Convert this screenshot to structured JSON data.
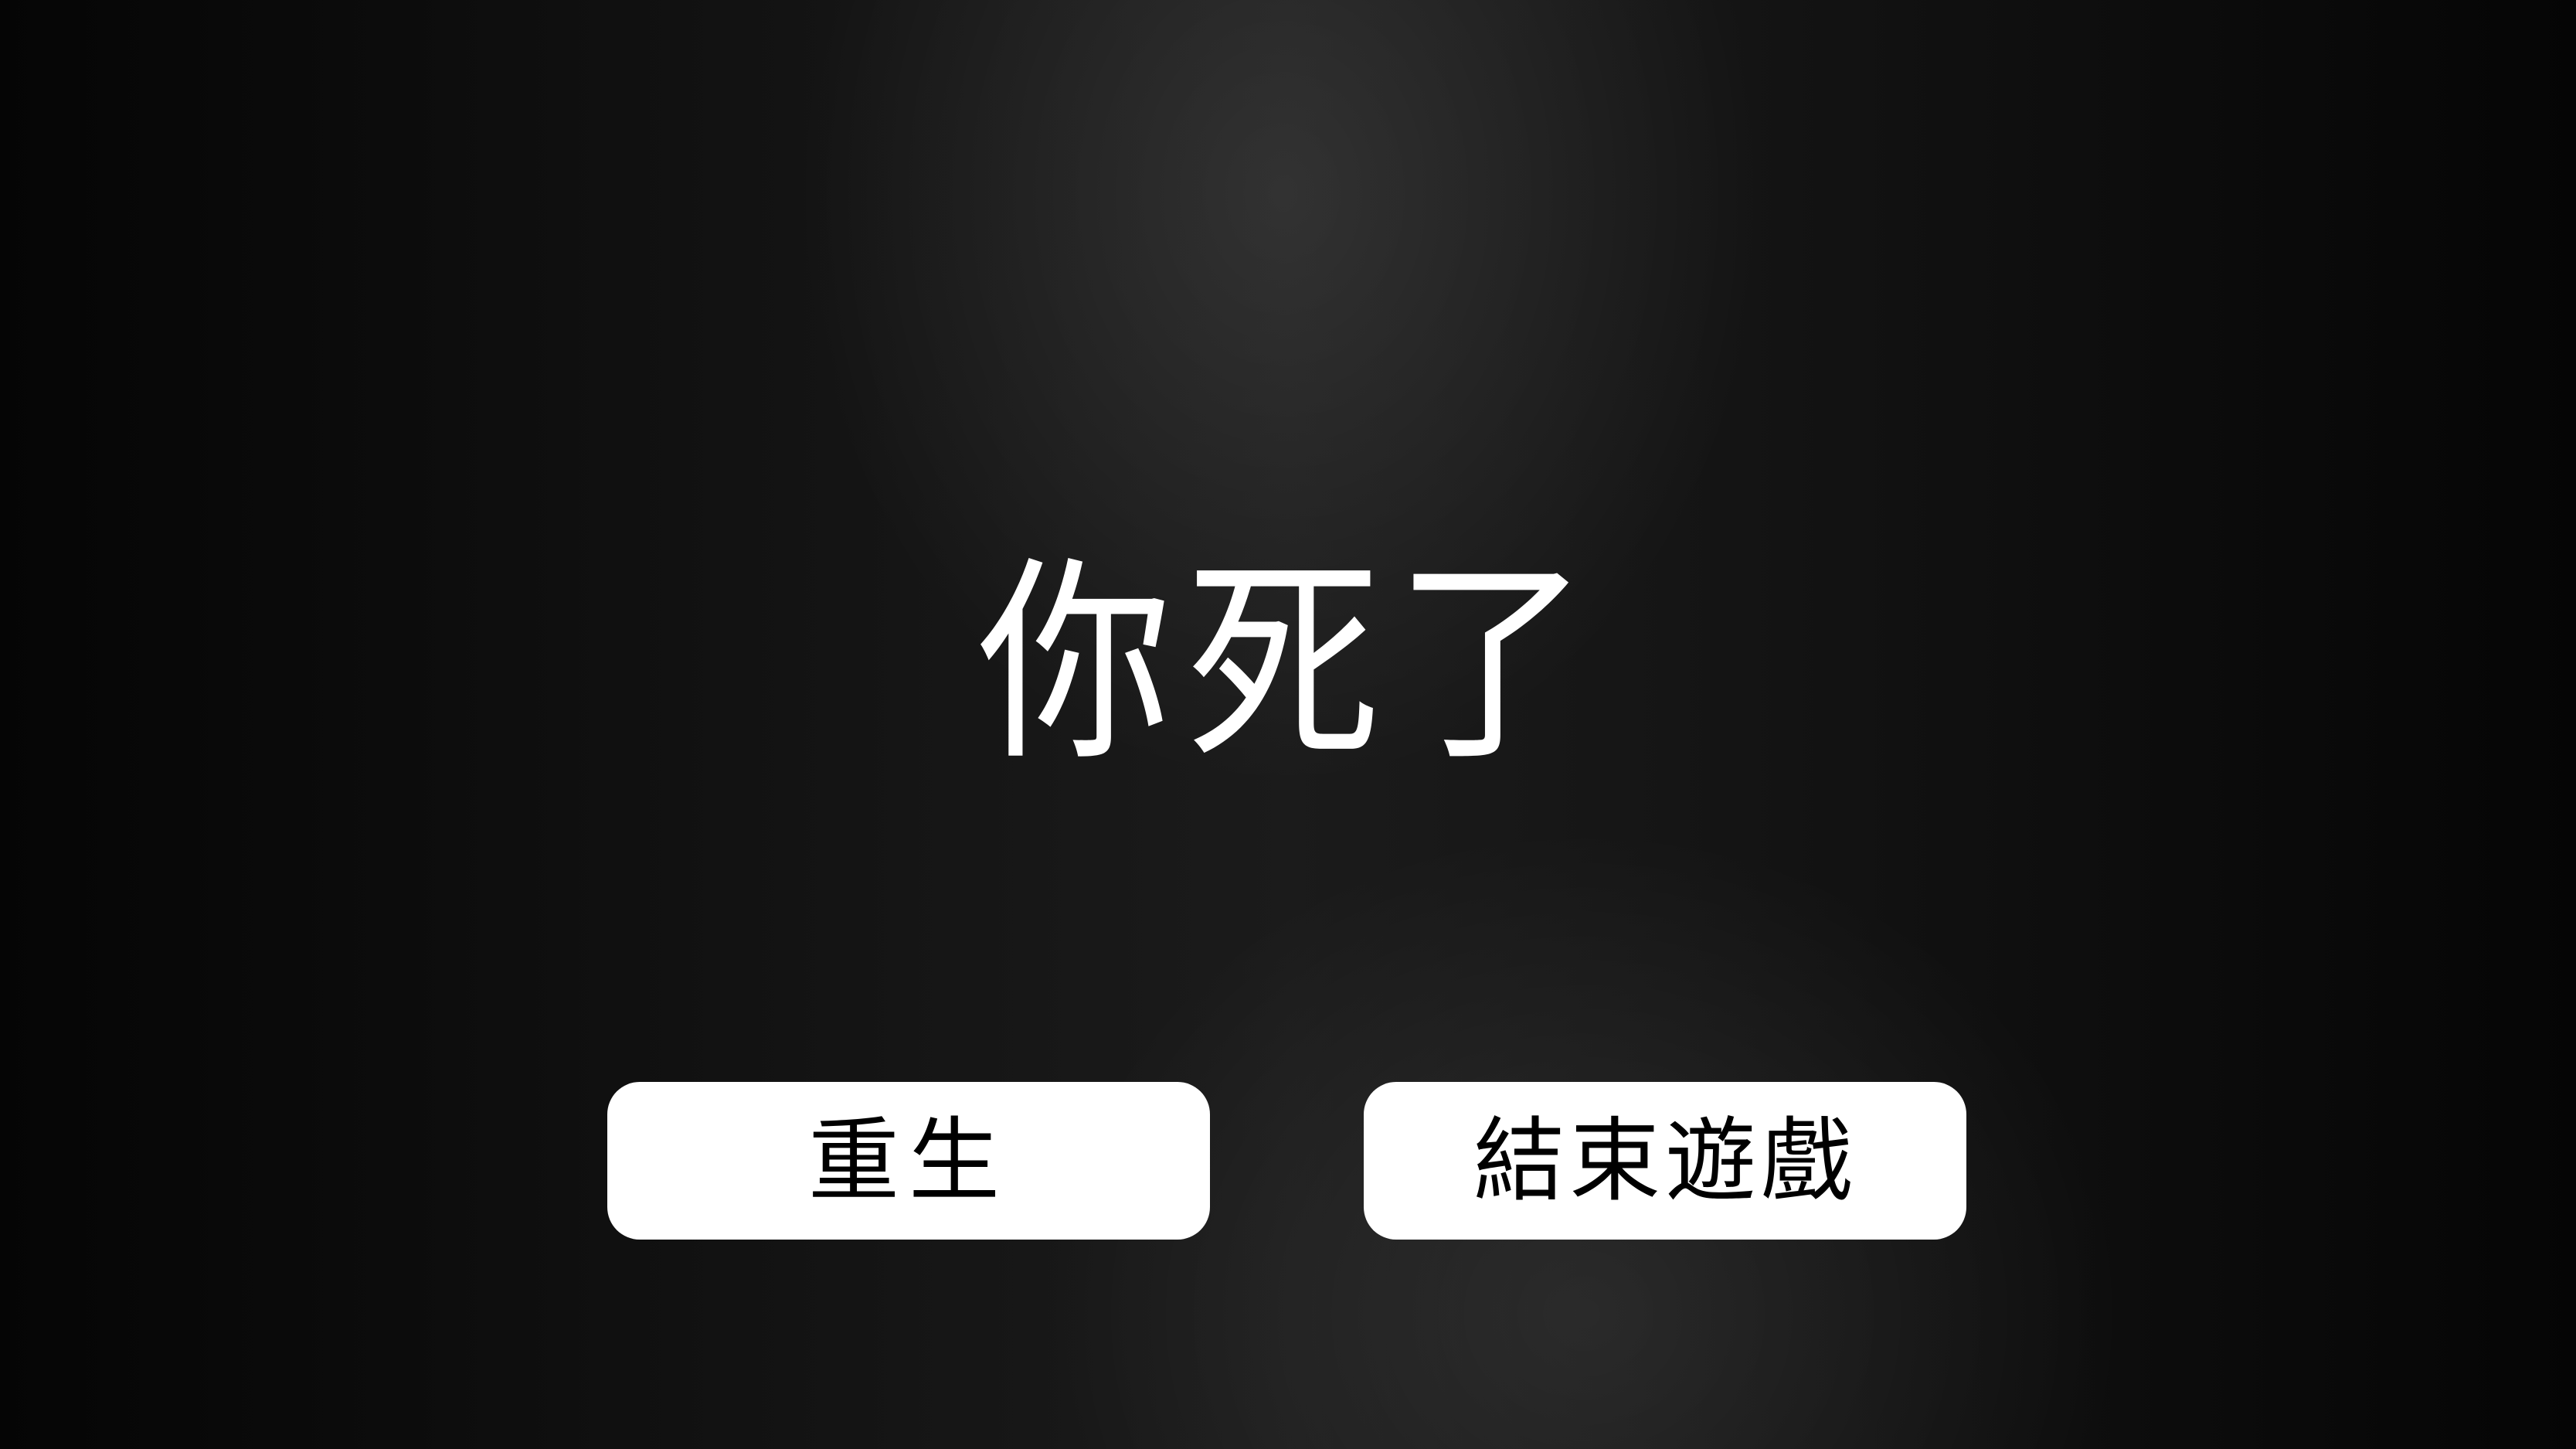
{
  "game_over": {
    "title": "你死了",
    "buttons": {
      "respawn_label": "重生",
      "quit_label": "結束遊戲"
    }
  },
  "colors": {
    "background": "#0b0b0b",
    "text": "#ffffff",
    "button_bg": "#ffffff",
    "button_text": "#000000"
  }
}
